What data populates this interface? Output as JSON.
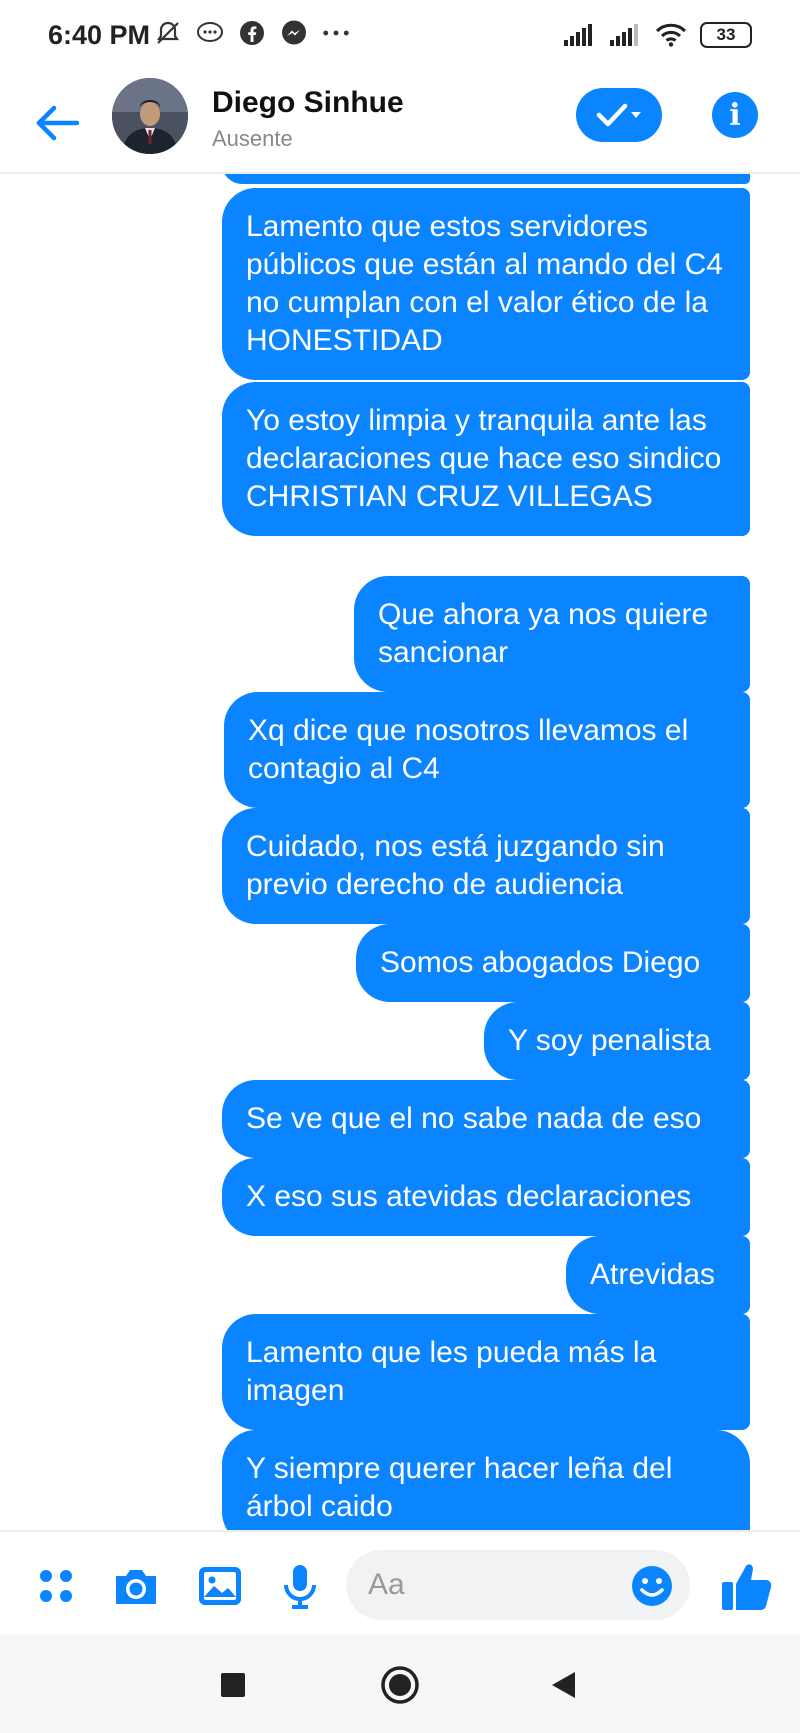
{
  "status_bar": {
    "time": "6:40 PM",
    "battery": "33",
    "left_icons": [
      "mute-icon",
      "messenger-bubble-icon",
      "facebook-icon",
      "messenger-icon",
      "more-dots-icon"
    ],
    "right_icons": [
      "signal-icon",
      "signal-icon",
      "wifi-icon",
      "battery-icon"
    ]
  },
  "header": {
    "name": "Diego Sinhue",
    "status": "Ausente",
    "back_icon": "back-arrow-icon",
    "check_icon": "check-dropdown-icon",
    "info_icon": "info-icon",
    "info_glyph": "i"
  },
  "messages": [
    {
      "text": "",
      "position": "partial"
    },
    {
      "text": "Lamento que estos servidores públicos que están al mando del C4 no cumplan con el valor ético de la HONESTIDAD"
    },
    {
      "text": "Yo estoy limpia y tranquila ante las declaraciones que hace eso sindico CHRISTIAN CRUZ VILLEGAS"
    },
    {
      "text": "Que ahora ya nos quiere sancionar"
    },
    {
      "text": "Xq dice que nosotros llevamos el contagio al C4"
    },
    {
      "text": "Cuidado, nos está juzgando sin previo derecho de audiencia"
    },
    {
      "text": "Somos abogados Diego"
    },
    {
      "text": "Y soy penalista"
    },
    {
      "text": "Se ve que el no sabe nada de eso"
    },
    {
      "text": "X eso sus atevidas declaraciones"
    },
    {
      "text": "Atrevidas"
    },
    {
      "text": "Lamento que les pueda más la imagen"
    },
    {
      "text": "Y siempre querer hacer leña del árbol caido"
    }
  ],
  "composer": {
    "placeholder": "Aa",
    "icons": [
      "menu-dots-icon",
      "camera-icon",
      "gallery-icon",
      "microphone-icon",
      "emoji-icon",
      "thumbs-up-icon"
    ]
  },
  "nav_bar": {
    "icons": [
      "recent-apps-icon",
      "home-icon",
      "back-icon"
    ]
  },
  "colors": {
    "accent": "#0b84ff",
    "bubble_text": "#ffffff",
    "secondary_text": "#888888"
  }
}
